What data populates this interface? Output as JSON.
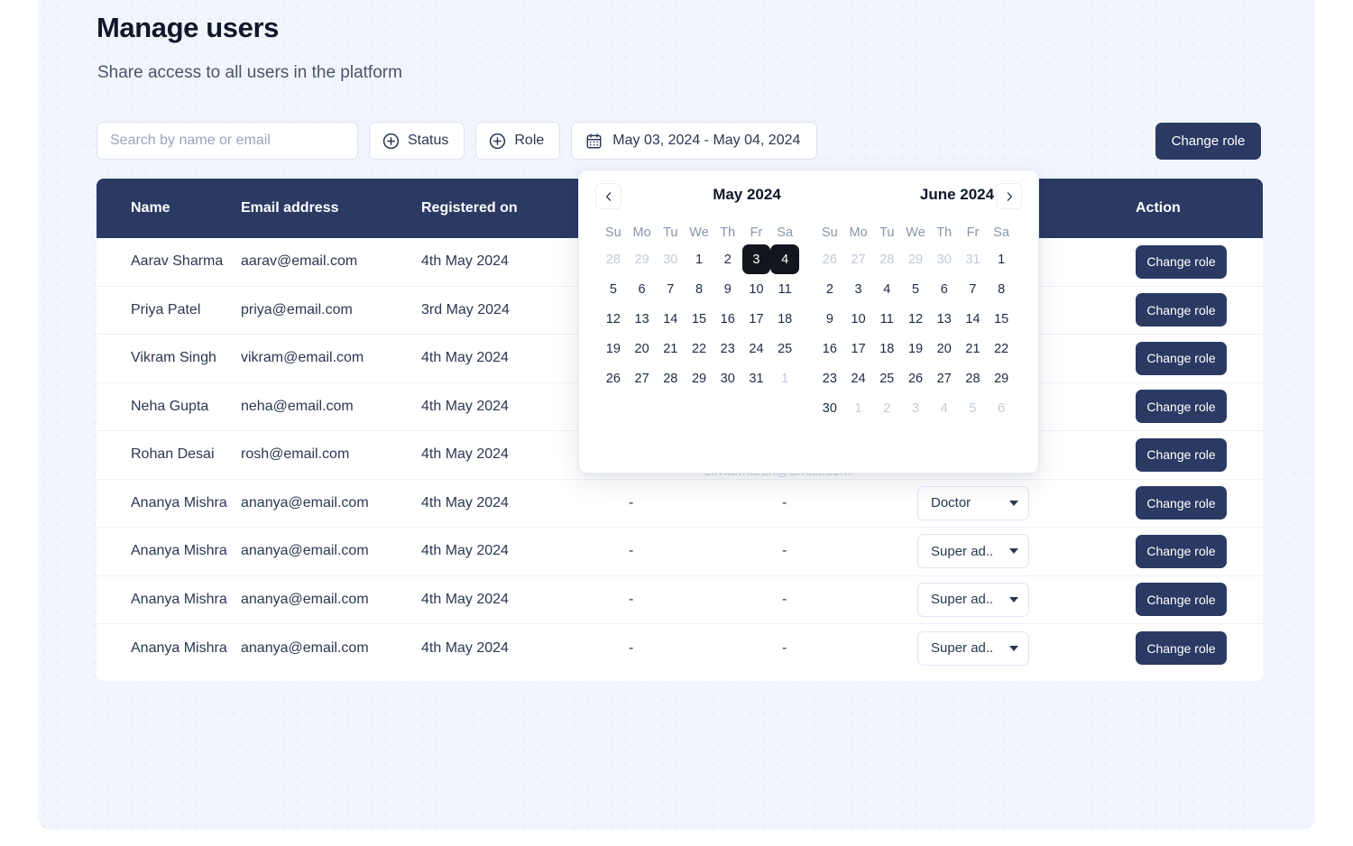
{
  "page": {
    "title": "Manage users",
    "subtitle": "Share access to all users in the platform"
  },
  "toolbar": {
    "search_placeholder": "Search by name or email",
    "search_value": "",
    "status_label": "Status",
    "role_label": "Role",
    "date_range_label": "May 03, 2024 - May 04, 2024",
    "change_role_label": "Change role"
  },
  "table": {
    "headers": {
      "name": "Name",
      "email": "Email address",
      "registered_on": "Registered on",
      "col4": "",
      "col5": "",
      "role": "",
      "action": "Action"
    },
    "rows": [
      {
        "name": "Aarav Sharma",
        "email": "aarav@email.com",
        "registered": "4th May 2024",
        "c4": "",
        "c5": "",
        "role": "",
        "action": "Change role"
      },
      {
        "name": "Priya Patel",
        "email": "priya@email.com",
        "registered": "3rd May 2024",
        "c4": "",
        "c5": "",
        "role": "",
        "action": "Change role"
      },
      {
        "name": "Vikram Singh",
        "email": "vikram@email.com",
        "registered": "4th May 2024",
        "c4": "",
        "c5": "",
        "role": "",
        "action": "Change role"
      },
      {
        "name": "Neha Gupta",
        "email": "neha@email.com",
        "registered": "4th May 2024",
        "c4": "",
        "c5": "",
        "role": "",
        "action": "Change role"
      },
      {
        "name": "Rohan Desai",
        "email": "rosh@email.com",
        "registered": "4th May 2024",
        "c4": "",
        "c5": "",
        "role": "",
        "action": "Change role"
      },
      {
        "name": "Ananya Mishra",
        "email": "ananya@email.com",
        "registered": "4th May 2024",
        "c4": "-",
        "c5": "-",
        "role": "Doctor",
        "action": "Change role"
      },
      {
        "name": "Ananya Mishra",
        "email": "ananya@email.com",
        "registered": "4th May 2024",
        "c4": "-",
        "c5": "-",
        "role": "Super ad..",
        "action": "Change role"
      },
      {
        "name": "Ananya Mishra",
        "email": "ananya@email.com",
        "registered": "4th May 2024",
        "c4": "-",
        "c5": "-",
        "role": "Super ad..",
        "action": "Change role"
      },
      {
        "name": "Ananya Mishra",
        "email": "ananya@email.com",
        "registered": "4th May 2024",
        "c4": "-",
        "c5": "-",
        "role": "Super ad..",
        "action": "Change role"
      }
    ],
    "obscured_text": "olivia.martin@email.com"
  },
  "calendar": {
    "prev_label": "‹",
    "next_label": "›",
    "left_month_title": "May 2024",
    "right_month_title": "June 2024",
    "weekdays": [
      "Su",
      "Mo",
      "Tu",
      "We",
      "Th",
      "Fr",
      "Sa"
    ],
    "left_weeks": [
      [
        {
          "d": "28",
          "m": true
        },
        {
          "d": "29",
          "m": true
        },
        {
          "d": "30",
          "m": true
        },
        {
          "d": "1"
        },
        {
          "d": "2"
        },
        {
          "d": "3",
          "s": true
        },
        {
          "d": "4",
          "s": true
        }
      ],
      [
        {
          "d": "5"
        },
        {
          "d": "6"
        },
        {
          "d": "7"
        },
        {
          "d": "8"
        },
        {
          "d": "9"
        },
        {
          "d": "10"
        },
        {
          "d": "11"
        }
      ],
      [
        {
          "d": "12"
        },
        {
          "d": "13"
        },
        {
          "d": "14"
        },
        {
          "d": "15"
        },
        {
          "d": "16"
        },
        {
          "d": "17"
        },
        {
          "d": "18"
        }
      ],
      [
        {
          "d": "19"
        },
        {
          "d": "20"
        },
        {
          "d": "21"
        },
        {
          "d": "22"
        },
        {
          "d": "23"
        },
        {
          "d": "24"
        },
        {
          "d": "25"
        }
      ],
      [
        {
          "d": "26"
        },
        {
          "d": "27"
        },
        {
          "d": "28"
        },
        {
          "d": "29"
        },
        {
          "d": "30"
        },
        {
          "d": "31"
        },
        {
          "d": "1",
          "m": true
        }
      ]
    ],
    "right_weeks": [
      [
        {
          "d": "26",
          "m": true
        },
        {
          "d": "27",
          "m": true
        },
        {
          "d": "28",
          "m": true
        },
        {
          "d": "29",
          "m": true
        },
        {
          "d": "30",
          "m": true
        },
        {
          "d": "31",
          "m": true
        },
        {
          "d": "1"
        }
      ],
      [
        {
          "d": "2"
        },
        {
          "d": "3"
        },
        {
          "d": "4"
        },
        {
          "d": "5"
        },
        {
          "d": "6"
        },
        {
          "d": "7"
        },
        {
          "d": "8"
        }
      ],
      [
        {
          "d": "9"
        },
        {
          "d": "10"
        },
        {
          "d": "11"
        },
        {
          "d": "12"
        },
        {
          "d": "13"
        },
        {
          "d": "14"
        },
        {
          "d": "15"
        }
      ],
      [
        {
          "d": "16"
        },
        {
          "d": "17"
        },
        {
          "d": "18"
        },
        {
          "d": "19"
        },
        {
          "d": "20"
        },
        {
          "d": "21"
        },
        {
          "d": "22"
        }
      ],
      [
        {
          "d": "23"
        },
        {
          "d": "24"
        },
        {
          "d": "25"
        },
        {
          "d": "26"
        },
        {
          "d": "27"
        },
        {
          "d": "28"
        },
        {
          "d": "29"
        }
      ],
      [
        {
          "d": "30"
        },
        {
          "d": "1",
          "m": true
        },
        {
          "d": "2",
          "m": true
        },
        {
          "d": "3",
          "m": true
        },
        {
          "d": "4",
          "m": true
        },
        {
          "d": "5",
          "m": true
        },
        {
          "d": "6",
          "m": true
        }
      ]
    ]
  },
  "icons": {
    "search": "search-icon",
    "plus_circle": "plus-circle-icon",
    "calendar": "calendar-icon",
    "chevron_left": "chevron-left-icon",
    "chevron_right": "chevron-right-icon",
    "chevron_down": "chevron-down-icon",
    "more_vertical": "more-vertical-icon"
  },
  "colors": {
    "page_bg": "#f2f5fd",
    "header_navy": "#2b3a63",
    "accent_dark": "#13151c",
    "text_primary": "#2b3751",
    "text_muted": "#8b94ab",
    "border": "#dbe2f0"
  }
}
